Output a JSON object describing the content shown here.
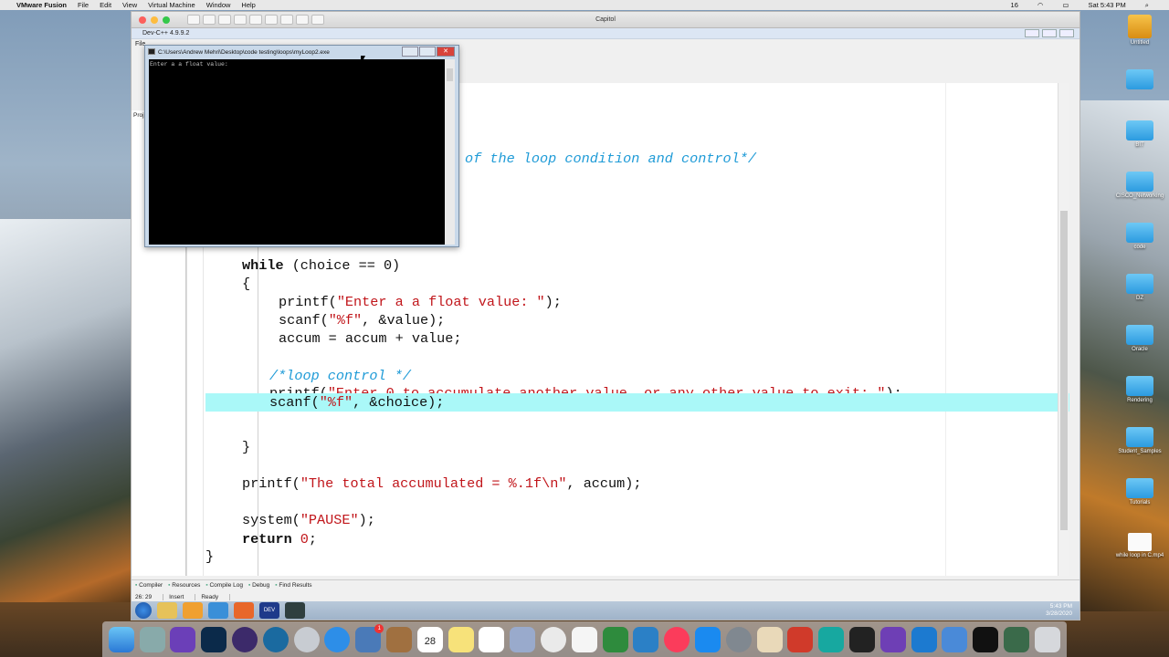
{
  "menubar": {
    "apple": "",
    "app": "VMware Fusion",
    "items": [
      "File",
      "Edit",
      "View",
      "Virtual Machine",
      "Window",
      "Help"
    ],
    "status_num": "16",
    "clock": "Sat 5:43 PM"
  },
  "vmware": {
    "title": "Capitol"
  },
  "devcpp": {
    "title": "Dev-C++ 4.9.9.2",
    "menu_fragment": "File",
    "proj_fragment": "Proj"
  },
  "console": {
    "title": "C:\\Users\\Andrew Mehri\\Desktop\\code testing\\loops\\myLoop2.exe",
    "output": "Enter a a float value:"
  },
  "code": {
    "line_comment_top": "of the loop condition and control*/",
    "line_while_kw": "while",
    "line_while_rest": " (choice == 0)",
    "line_open_brace": "{",
    "l_printf1_a": "printf(",
    "l_printf1_str": "\"Enter a a float value: \"",
    "l_printf1_b": ");",
    "l_scanf1_a": "scanf(",
    "l_scanf1_str": "\"%f\"",
    "l_scanf1_b": ", &value);",
    "l_accum": "accum = accum + value;",
    "l_comment_loop": "/*loop control */",
    "l_printf2_a": "printf(",
    "l_printf2_str": "\"Enter 0 to accumulate another value, or any other value to exit: \"",
    "l_printf2_b": ");",
    "l_scanf2_a": "scanf(",
    "l_scanf2_str": "\"%f\"",
    "l_scanf2_b": ", &choice);",
    "l_close_brace_inner": "}",
    "l_printf3_a": "printf(",
    "l_printf3_str": "\"The total accumulated = %.1f\\n\"",
    "l_printf3_b": ", accum);",
    "l_system_a": "system(",
    "l_system_str": "\"PAUSE\"",
    "l_system_b": ");",
    "l_return_kw": "return",
    "l_return_num": " 0",
    "l_return_b": ";",
    "l_close_brace_outer": "}"
  },
  "bottom_tabs": [
    "Compiler",
    "Resources",
    "Compile Log",
    "Debug",
    "Find Results"
  ],
  "status": {
    "position": "26: 29",
    "mode": "Insert",
    "state": "Ready"
  },
  "taskbar": {
    "time": "5:43 PM",
    "date": "3/28/2020"
  },
  "desktop_icons": [
    "Untitled",
    "",
    "BIT",
    "CISCO_Networking",
    "code",
    "DZ",
    "Oracle",
    "Rendering",
    "Student_Samples",
    "Tutorials",
    "while loop in C.mp4"
  ],
  "dock": {
    "badge1": "1",
    "calendar_day": "28"
  }
}
